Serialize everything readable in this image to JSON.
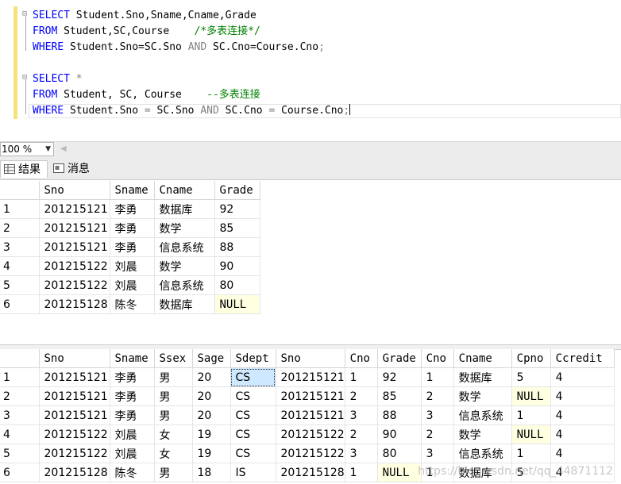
{
  "editor": {
    "lines": [
      {
        "parts": [
          [
            "kw",
            "SELECT"
          ],
          [
            "",
            " Student.Sno,Sname,Cname,Grade"
          ]
        ]
      },
      {
        "parts": [
          [
            "kw",
            "FROM"
          ],
          [
            "",
            " Student,SC,Course    "
          ],
          [
            "cm",
            "/*多表连接*/"
          ]
        ]
      },
      {
        "parts": [
          [
            "kw",
            "WHERE"
          ],
          [
            "",
            " Student.Sno=SC.Sno "
          ],
          [
            "op",
            "AND"
          ],
          [
            "",
            " SC.Cno=Course.Cno"
          ],
          [
            "op",
            ";"
          ]
        ]
      },
      {
        "parts": []
      },
      {
        "parts": [
          [
            "kw",
            "SELECT"
          ],
          [
            "",
            " "
          ],
          [
            "op",
            "*"
          ]
        ]
      },
      {
        "parts": [
          [
            "kw",
            "FROM"
          ],
          [
            "",
            " Student, SC, Course    "
          ],
          [
            "cm",
            "--多表连接"
          ]
        ]
      },
      {
        "parts": [
          [
            "kw",
            "WHERE"
          ],
          [
            "",
            " Student.Sno "
          ],
          [
            "op",
            "="
          ],
          [
            "",
            " SC.Sno "
          ],
          [
            "op",
            "AND"
          ],
          [
            "",
            " SC.Cno "
          ],
          [
            "op",
            "="
          ],
          [
            "",
            " Course.Cno"
          ],
          [
            "op",
            ";"
          ]
        ]
      }
    ]
  },
  "zoom": {
    "value": "100 %"
  },
  "tabs": {
    "results": "结果",
    "messages": "消息"
  },
  "grid1": {
    "columns": [
      "Sno",
      "Sname",
      "Cname",
      "Grade"
    ],
    "rows": [
      [
        "1",
        "201215121",
        "李勇",
        "数据库",
        "92"
      ],
      [
        "2",
        "201215121",
        "李勇",
        "数学",
        "85"
      ],
      [
        "3",
        "201215121",
        "李勇",
        "信息系统",
        "88"
      ],
      [
        "4",
        "201215122",
        "刘晨",
        "数学",
        "90"
      ],
      [
        "5",
        "201215122",
        "刘晨",
        "信息系统",
        "80"
      ],
      [
        "6",
        "201215128",
        "陈冬",
        "数据库",
        "NULL"
      ]
    ]
  },
  "grid2": {
    "columns": [
      "Sno",
      "Sname",
      "Ssex",
      "Sage",
      "Sdept",
      "Sno",
      "Cno",
      "Grade",
      "Cno",
      "Cname",
      "Cpno",
      "Ccredit"
    ],
    "rows": [
      [
        "1",
        "201215121",
        "李勇",
        "男",
        "20",
        "CS",
        "201215121",
        "1",
        "92",
        "1",
        "数据库",
        "5",
        "4"
      ],
      [
        "2",
        "201215121",
        "李勇",
        "男",
        "20",
        "CS",
        "201215121",
        "2",
        "85",
        "2",
        "数学",
        "NULL",
        "4"
      ],
      [
        "3",
        "201215121",
        "李勇",
        "男",
        "20",
        "CS",
        "201215121",
        "3",
        "88",
        "3",
        "信息系统",
        "1",
        "4"
      ],
      [
        "4",
        "201215122",
        "刘晨",
        "女",
        "19",
        "CS",
        "201215122",
        "2",
        "90",
        "2",
        "数学",
        "NULL",
        "4"
      ],
      [
        "5",
        "201215122",
        "刘晨",
        "女",
        "19",
        "CS",
        "201215122",
        "3",
        "80",
        "3",
        "信息系统",
        "1",
        "4"
      ],
      [
        "6",
        "201215128",
        "陈冬",
        "男",
        "18",
        "IS",
        "201215128",
        "1",
        "NULL",
        "1",
        "数据库",
        "5",
        "4"
      ]
    ]
  },
  "watermark": "https://blog.csdn.net/qq_44871112"
}
